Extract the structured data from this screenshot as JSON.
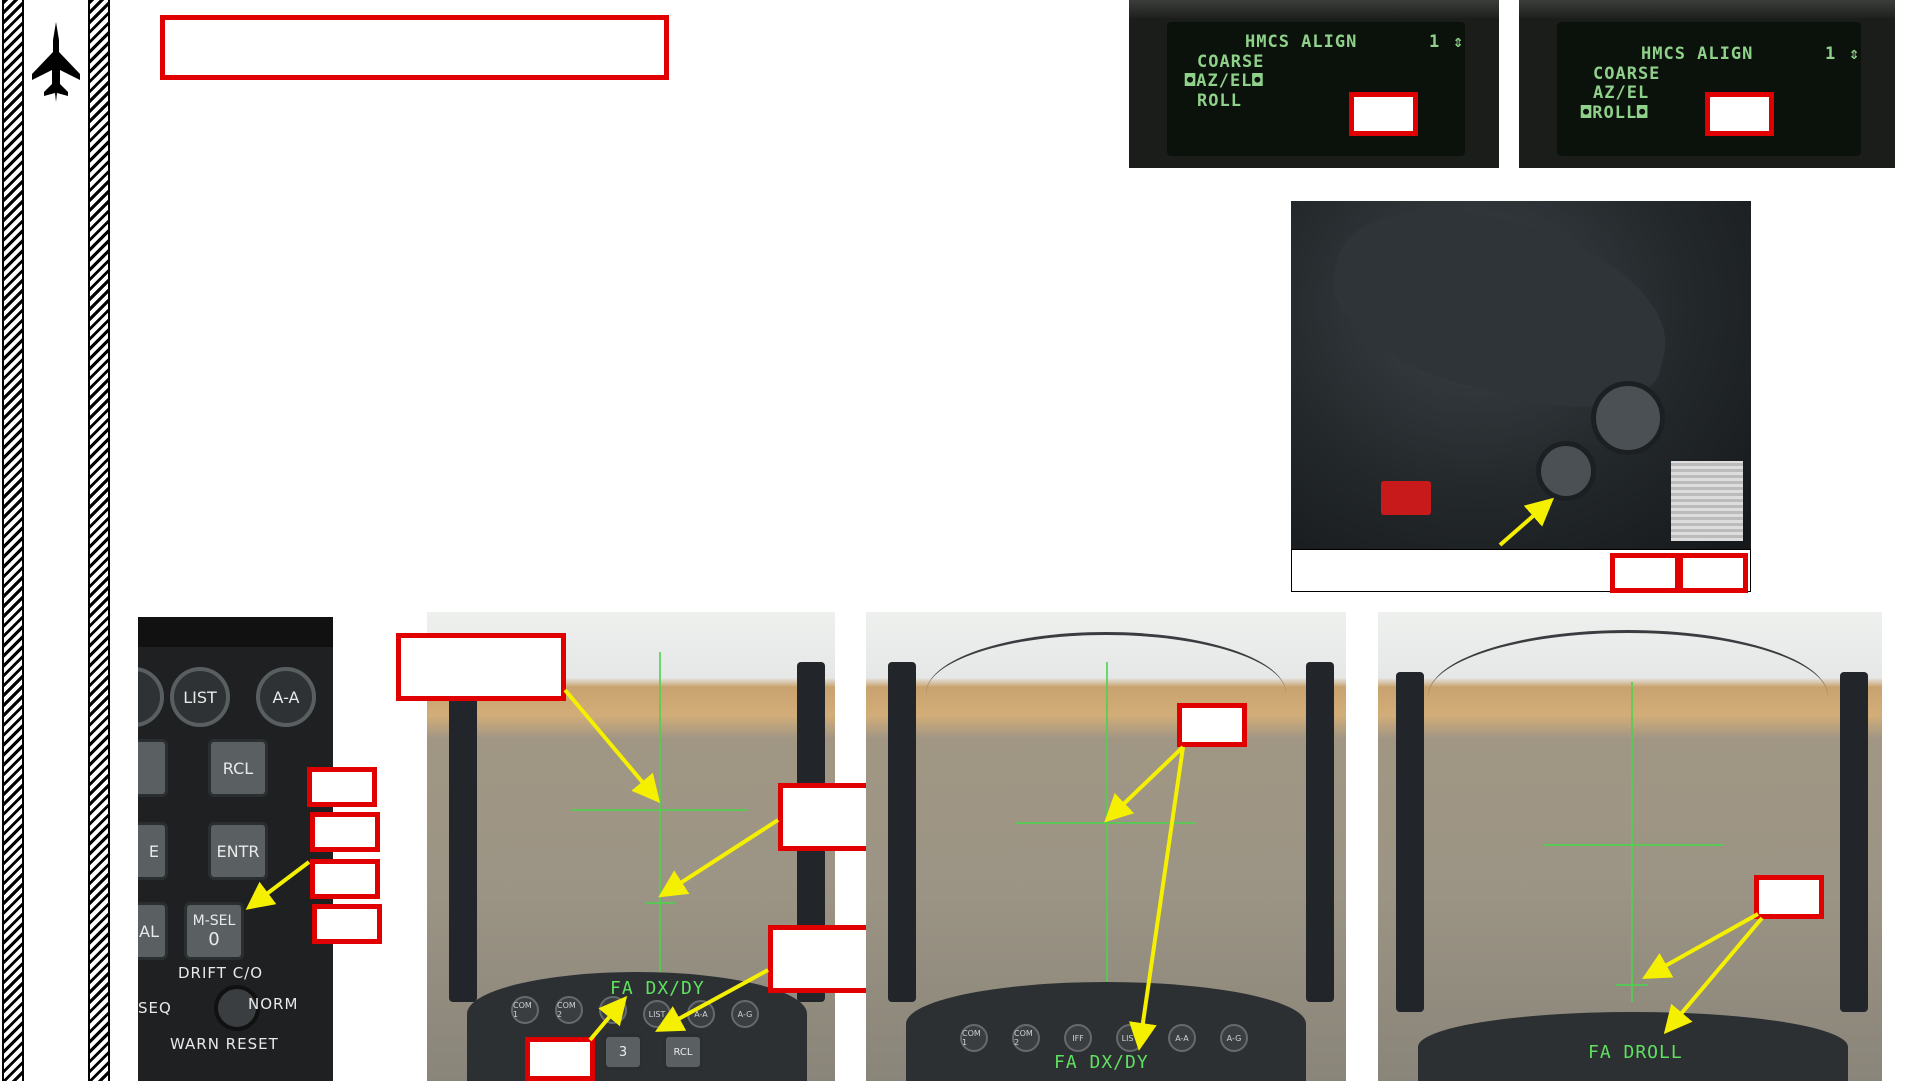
{
  "ded_left": {
    "title": "HMCS ALIGN",
    "page_num": "1",
    "updown": "⇕",
    "line1": "COARSE",
    "line2": "◘AZ/EL◘",
    "line3": "ROLL"
  },
  "ded_right": {
    "title": "HMCS ALIGN",
    "page_num": "1",
    "updown": "⇕",
    "line1": "COARSE",
    "line2": "AZ/EL",
    "line3": "◘ROLL◘"
  },
  "icp": {
    "list": "LIST",
    "aa": "A-A",
    "rcl": "RCL",
    "entr": "ENTR",
    "msel": "M-SEL",
    "msel_digit": "0",
    "e_frag": "E",
    "al_frag": "AL",
    "drift": "DRIFT C/O",
    "seq": "SEQ",
    "norm": "NORM",
    "warn": "WARN RESET"
  },
  "hud": {
    "scene1_text": "FA DX/DY",
    "scene2_text": "FA DX/DY",
    "scene3_text": "FA DROLL"
  },
  "panel_buttons": {
    "com1": "COM 1",
    "com2": "COM 2",
    "iff": "IFF",
    "list": "LIST",
    "aa": "A-A",
    "ag": "A-G",
    "key3": "3",
    "rcl": "RCL"
  },
  "colors": {
    "callout_red": "#e00000",
    "arrow_yellow": "#f5f000",
    "hud_green": "#4cd24c"
  }
}
